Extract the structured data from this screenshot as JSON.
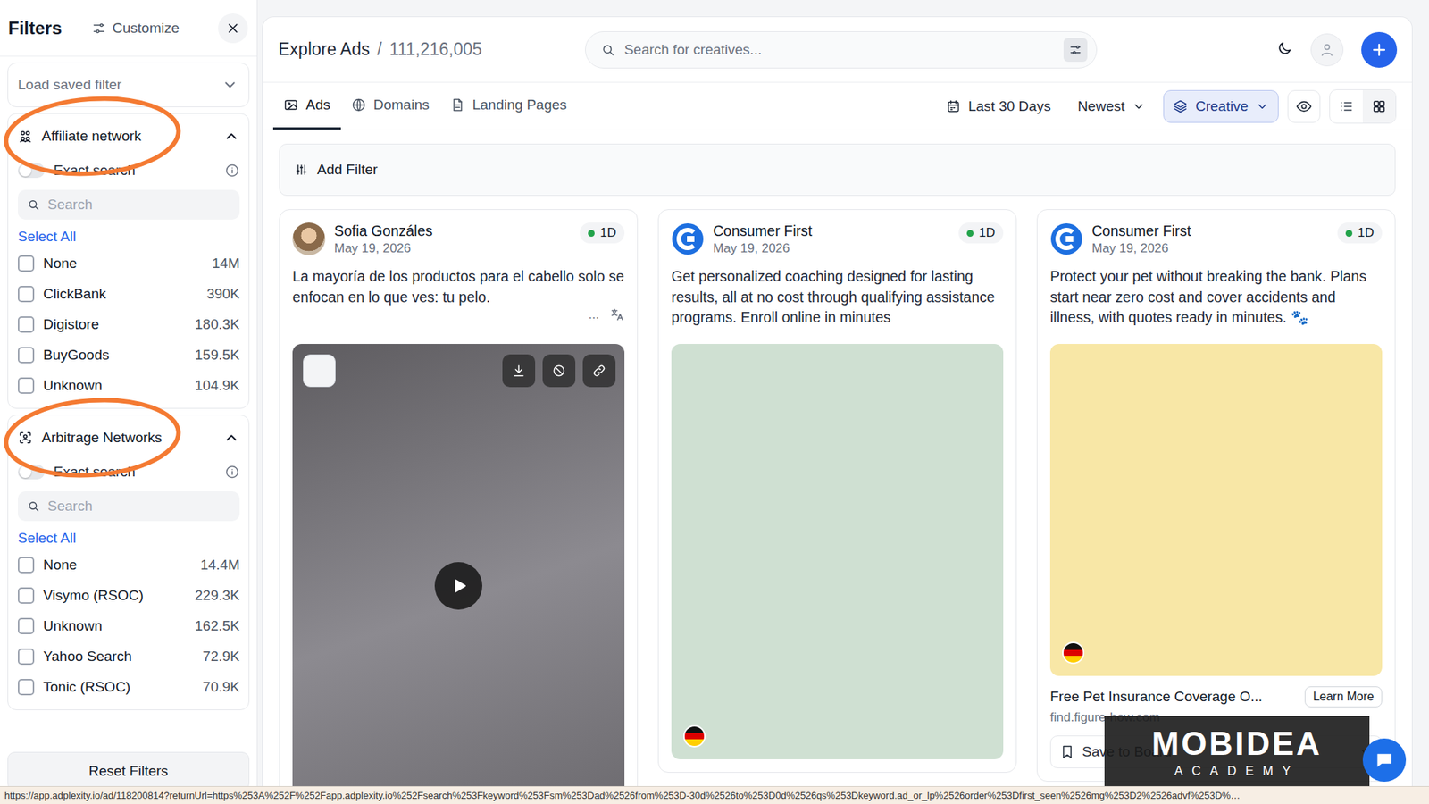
{
  "sidebar": {
    "title": "Filters",
    "customize": "Customize",
    "saved_filter": {
      "placeholder": "Load saved filter"
    },
    "sections": [
      {
        "kind": "affiliate",
        "title": "Affiliate network",
        "expanded": true,
        "highlighted": true,
        "exact_search": {
          "label": "Exact search",
          "on": false
        },
        "search": {
          "placeholder": "Search"
        },
        "select_all": "Select All",
        "options": [
          {
            "label": "None",
            "count": "14M",
            "checked": false
          },
          {
            "label": "ClickBank",
            "count": "390K",
            "checked": false
          },
          {
            "label": "Digistore",
            "count": "180.3K",
            "checked": false
          },
          {
            "label": "BuyGoods",
            "count": "159.5K",
            "checked": false
          },
          {
            "label": "Unknown",
            "count": "104.9K",
            "checked": false
          }
        ]
      },
      {
        "kind": "arbitrage",
        "title": "Arbitrage Networks",
        "expanded": true,
        "highlighted": true,
        "exact_search": {
          "label": "Exact search",
          "on": false
        },
        "search": {
          "placeholder": "Search"
        },
        "select_all": "Select All",
        "options": [
          {
            "label": "None",
            "count": "14.4M",
            "checked": false
          },
          {
            "label": "Visymo (RSOC)",
            "count": "229.3K",
            "checked": false
          },
          {
            "label": "Unknown",
            "count": "162.5K",
            "checked": false
          },
          {
            "label": "Yahoo Search",
            "count": "72.9K",
            "checked": false
          },
          {
            "label": "Tonic (RSOC)",
            "count": "70.9K",
            "checked": false
          }
        ]
      }
    ],
    "reset": "Reset Filters"
  },
  "header": {
    "title": "Explore Ads",
    "separator": "/",
    "count": "111,216,005",
    "search": {
      "placeholder": "Search for creatives..."
    }
  },
  "tabs": [
    {
      "label": "Ads",
      "kind": "image",
      "selected": true
    },
    {
      "label": "Domains",
      "kind": "globe",
      "selected": false
    },
    {
      "label": "Landing Pages",
      "kind": "doc",
      "selected": false
    }
  ],
  "toolbar": {
    "date_range": "Last 30 Days",
    "sort": "Newest",
    "mode": "Creative",
    "views": [
      {
        "kind": "list",
        "selected": false
      },
      {
        "kind": "grid",
        "selected": true
      }
    ]
  },
  "add_filter": "Add Filter",
  "ads": [
    {
      "author": "Sofia Gonzáles",
      "avatar": "photo",
      "date": "May 19, 2026",
      "age": "1D",
      "text": "La mayoría de los productos para el cabello solo se enfocan en lo que ves: tu pelo.",
      "more": "...",
      "translate": true,
      "media": {
        "kind": "video",
        "color": "#5e5c60",
        "flag": false,
        "controls": true
      },
      "footer": null
    },
    {
      "author": "Consumer First",
      "avatar": "logo",
      "date": "May 19, 2026",
      "age": "1D",
      "text": "Get personalized coaching designed for lasting results, all at no cost through qualifying assistance programs. Enroll online in minutes",
      "more": null,
      "translate": false,
      "media": {
        "kind": "portrait",
        "color": "#cfe0d2",
        "flag": true,
        "controls": false
      },
      "footer": null
    },
    {
      "author": "Consumer First",
      "avatar": "logo",
      "date": "May 19, 2026",
      "age": "1D",
      "text": "Protect your pet without breaking the bank. Plans start near zero cost and cover accidents and illness, with quotes ready in minutes. 🐾",
      "more": null,
      "translate": false,
      "media": {
        "kind": "square",
        "color": "#f8e7a6",
        "flag": true,
        "controls": false
      },
      "footer": {
        "title": "Free Pet Insurance Coverage O...",
        "cta": "Learn More",
        "domain": "find.figure-how.com",
        "save": "Save to Board"
      }
    }
  ],
  "watermark": {
    "brand": "MOBIDEA",
    "sub": "ACADEMY"
  },
  "status_bar": "https://app.adplexity.io/ad/118200814?returnUrl=https%253A%252F%252Fapp.adplexity.io%252Fsearch%253Fkeyword%253Fsm%253Dad%2526from%253D-30d%2526to%253D0d%2526qs%253Dkeyword.ad_or_lp%2526order%253Dfirst_seen%2526mg%253D2%2526advf%253D%…"
}
